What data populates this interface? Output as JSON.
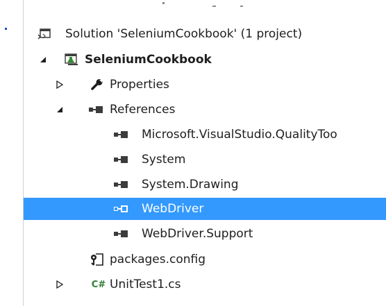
{
  "solution_explorer": {
    "solution": {
      "label": "Solution 'SeleniumCookbook' (1 project)",
      "icon": "solution-icon"
    },
    "project": {
      "label": "SeleniumCookbook",
      "icon": "test-project-icon",
      "expanded": true
    },
    "properties": {
      "label": "Properties",
      "icon": "wrench-icon",
      "expanded": false
    },
    "references": {
      "label": "References",
      "icon": "references-icon",
      "expanded": true,
      "items": [
        {
          "label": "Microsoft.VisualStudio.QualityToo",
          "icon": "reference-icon"
        },
        {
          "label": "System",
          "icon": "reference-icon"
        },
        {
          "label": "System.Drawing",
          "icon": "reference-icon"
        },
        {
          "label": "WebDriver",
          "icon": "reference-icon",
          "selected": true
        },
        {
          "label": "WebDriver.Support",
          "icon": "reference-icon"
        }
      ]
    },
    "packages_config": {
      "label": "packages.config",
      "icon": "config-file-icon"
    },
    "unittest": {
      "label": "UnitTest1.cs",
      "icon": "csharp-file-icon",
      "icon_text": "C#",
      "expanded": false
    }
  },
  "colors": {
    "selection": "#3399ff",
    "text": "#1e1e1e",
    "csharp_green": "#2e7d32",
    "project_icon_green": "#2f8f2f"
  }
}
